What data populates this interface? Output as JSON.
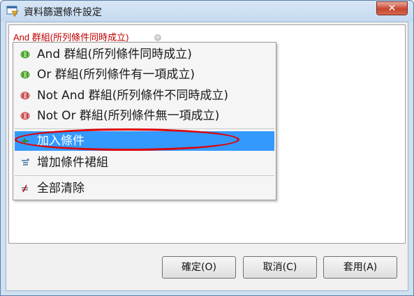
{
  "window": {
    "title": "資料篩選條件設定",
    "close_label": "✕"
  },
  "filter": {
    "group_label": "And 群組(所列條件同時成立)",
    "group_add_symbol": "+"
  },
  "menu": {
    "items": [
      {
        "label": "And 群組(所列條件同時成立)",
        "icon": "green-group-icon",
        "color": "#3a9a2a"
      },
      {
        "label": "Or 群組(所列條件有一項成立)",
        "icon": "green-group-icon",
        "color": "#3a9a2a"
      },
      {
        "label": "Not And 群組(所列條件不同時成立)",
        "icon": "red-group-icon",
        "color": "#c94040"
      },
      {
        "label": "Not Or 群組(所列條件無一項成立)",
        "icon": "red-group-icon",
        "color": "#c94040"
      },
      {
        "label": "加入條件",
        "icon": "add-condition-icon",
        "highlighted": true
      },
      {
        "label": "增加條件裙組",
        "icon": "add-group-icon"
      },
      {
        "label": "全部清除",
        "icon": "clear-all-icon"
      }
    ]
  },
  "buttons": {
    "ok": "確定(O)",
    "cancel": "取消(C)",
    "apply": "套用(A)"
  }
}
